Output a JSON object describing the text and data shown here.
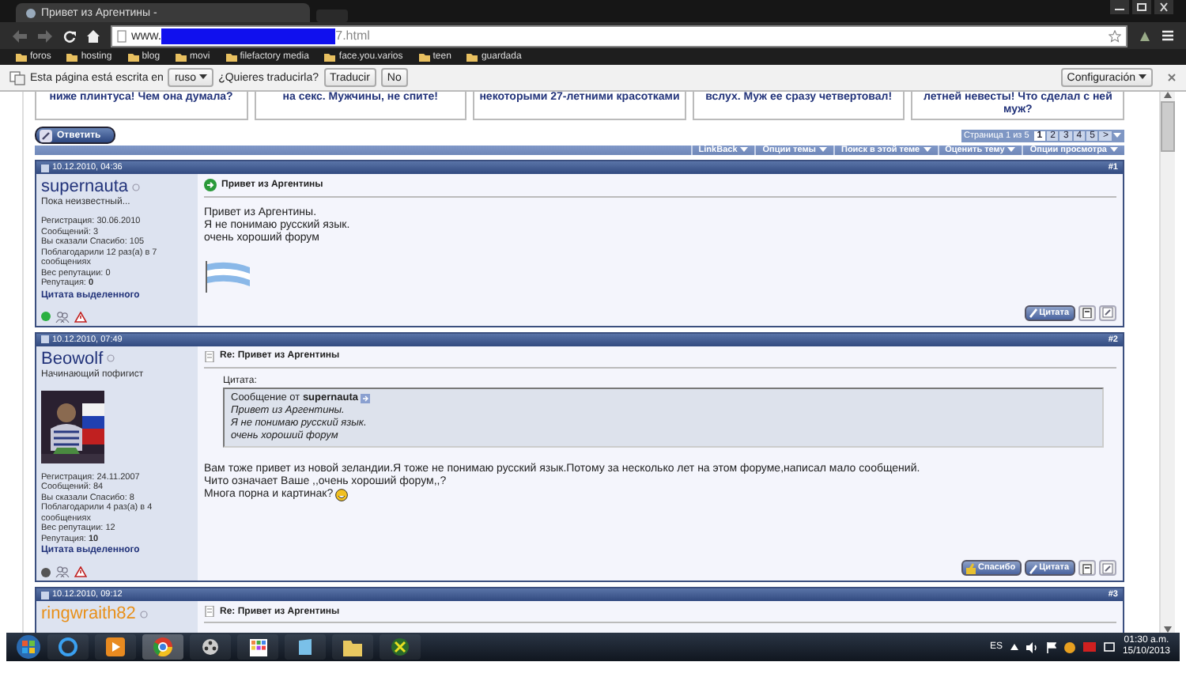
{
  "browser": {
    "tab_title": "Привет из Аргентины - ",
    "url": {
      "prefix": "www.",
      "suffix": "7.html"
    },
    "bookmarks": [
      {
        "label": "foros"
      },
      {
        "label": "hosting"
      },
      {
        "label": "blog"
      },
      {
        "label": "movi"
      },
      {
        "label": "filefactory media"
      },
      {
        "label": "face.you.varios"
      },
      {
        "label": "teen"
      },
      {
        "label": "guardada"
      }
    ],
    "translate_bar": {
      "lead": "Esta página está escrita en",
      "language": "ruso",
      "question": "¿Quieres traducirla?",
      "translate": "Traducir",
      "decline": "No",
      "settings": "Configuración"
    }
  },
  "forum": {
    "related": [
      {
        "lines": [
          "ниже плинтуса! Чем она думала?"
        ]
      },
      {
        "lines": [
          "на секс. Мужчины, не спите!"
        ]
      },
      {
        "lines": [
          "некоторыми 27-летними красотками"
        ]
      },
      {
        "lines": [
          "вслух. Муж ее сразу четвертовал!"
        ]
      },
      {
        "lines": [
          "летней невесты! Что сделал с ней",
          "муж?"
        ]
      }
    ],
    "reply_button": "Ответить",
    "pagination": {
      "label": "Страница 1 из 5",
      "pages": [
        {
          "label": "1",
          "selected": true
        },
        {
          "label": "2",
          "selected": false
        },
        {
          "label": "3",
          "selected": false
        },
        {
          "label": "4",
          "selected": false
        },
        {
          "label": "5",
          "selected": false
        },
        {
          "label": ">",
          "selected": false
        }
      ]
    },
    "menus": [
      "LinkBack",
      "Опции темы",
      "Поиск в этой теме",
      "Оценить тему",
      "Опции просмотра"
    ],
    "posts": [
      {
        "date": "10.12.2010, 04:36",
        "number": "#1",
        "kind": "first",
        "user": {
          "name": "supernauta",
          "color": "#22337a",
          "title": "Пока неизвестный...",
          "avatar": false,
          "stats": [
            "Регистрация: 30.06.2010",
            "Сообщений: 3",
            "Вы сказали Спасибо: 105",
            "Поблагодарили 12 раз(а) в 7 сообщениях",
            "Вес репутации: 0",
            "Репутация: **0**"
          ],
          "quote_link": "Цитата выделенного",
          "online": true
        },
        "title": "Привет из Аргентины",
        "body": [
          "Привет из Аргентины.",
          "Я не понимаю русский язык.",
          "очень хороший форум"
        ],
        "flag": true,
        "buttons": [
          {
            "kind": "quote",
            "label": "Цитата"
          },
          {
            "kind": "multiquote"
          },
          {
            "kind": "quickreply"
          }
        ]
      },
      {
        "date": "10.12.2010, 07:49",
        "number": "#2",
        "kind": "reply",
        "user": {
          "name": "Beowolf",
          "color": "#22337a",
          "title": "Начинающий пофигист",
          "avatar": true,
          "stats": [
            "Регистрация: 24.11.2007",
            "Сообщений: 84",
            "Вы сказали Спасибо: 8",
            "Поблагодарили 4 раз(а) в 4 сообщениях",
            "Вес репутации: 12",
            "Репутация: **10**"
          ],
          "quote_link": "Цитата выделенного",
          "online": false
        },
        "title": "Re: Привет из Аргентины",
        "quote": {
          "caption": "Цитата:",
          "from": "Сообщение от **supernauta**",
          "lines": [
            "Привет из Аргентины.",
            "Я не понимаю русский язык.",
            "очень хороший форум"
          ]
        },
        "body": [
          "Вам тоже привет из новой зеландии.Я тоже не понимаю русский язык.Потому за несколько лет на этом форуме,написал мало сообщений.",
          "Чито означает Ваше ,,очень хороший форум,,?",
          "Многа порна и картинак?"
        ],
        "smiley": true,
        "flag": false,
        "buttons": [
          {
            "kind": "thanks",
            "label": "Спасибо"
          },
          {
            "kind": "quote",
            "label": "Цитата"
          },
          {
            "kind": "multiquote"
          },
          {
            "kind": "quickreply"
          }
        ]
      },
      {
        "date": "10.12.2010, 09:12",
        "number": "#3",
        "kind": "reply",
        "user": {
          "name": "ringwraith82",
          "color": "#e8901a",
          "avatar": false
        },
        "title": "Re: Привет из Аргентины"
      }
    ]
  },
  "taskbar": {
    "language": "ES",
    "time": "01:30 a.m.",
    "date": "15/10/2013"
  }
}
